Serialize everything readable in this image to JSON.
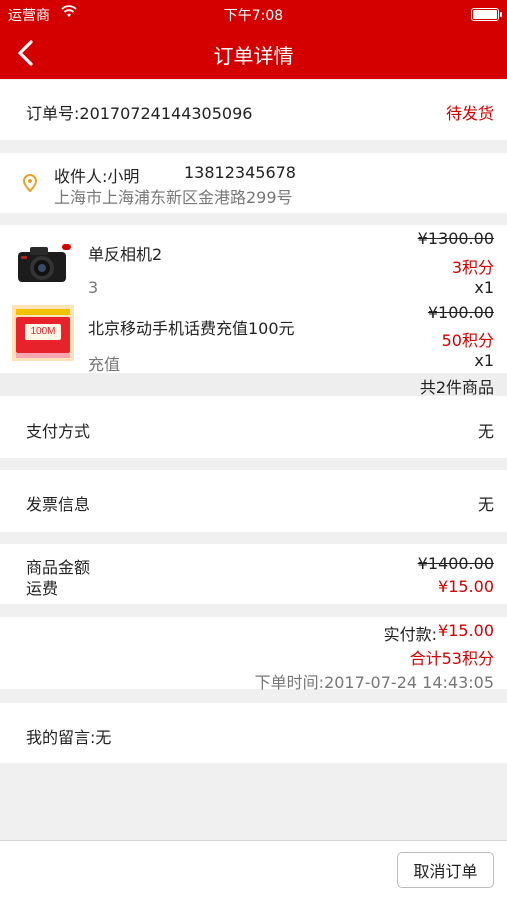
{
  "status_bar": {
    "carrier": "运营商",
    "time": "下午7:08"
  },
  "nav": {
    "title": "订单详情"
  },
  "order": {
    "number": "订单号:20170724144305096",
    "status": "待发货"
  },
  "address": {
    "receiver": "收件人:小明",
    "phone": "13812345678",
    "detail": "上海市上海浦东新区金港路299号"
  },
  "goods": [
    {
      "name": "单反相机2",
      "spec": "3",
      "original_price": "¥1300.00",
      "points": "3积分",
      "quantity": "x1"
    },
    {
      "name": "北京移动手机话费充值100元",
      "spec": "充值",
      "original_price": "¥100.00",
      "points": "50积分",
      "quantity": "x1",
      "thumb_text": "100M"
    }
  ],
  "goods_count": "共2件商品",
  "payment": {
    "label": "支付方式",
    "value": "无"
  },
  "invoice": {
    "label": "发票信息",
    "value": "无"
  },
  "amount": {
    "goods_label": "商品金额",
    "goods_value": "¥1400.00",
    "shipping_label": "运费",
    "shipping_value": "¥15.00"
  },
  "paid": {
    "label": "实付款:",
    "value": "¥15.00",
    "points_total": "合计53积分",
    "order_time": "下单时间:2017-07-24 14:43:05"
  },
  "message": {
    "text": "我的留言:无"
  },
  "actions": {
    "cancel_label": "取消订单"
  },
  "colors": {
    "brand_red": "#d40000",
    "background": "#f0f0f0"
  }
}
